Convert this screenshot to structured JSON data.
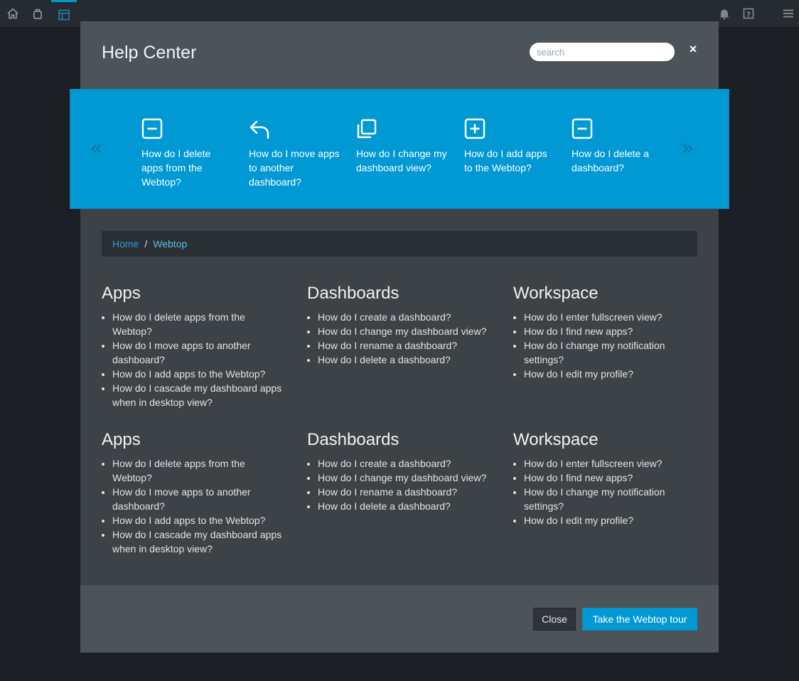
{
  "topbar": {
    "left_icons": [
      "home-icon",
      "bag-icon",
      "layout-icon"
    ],
    "right_icons": [
      "bell-icon",
      "help-icon",
      "menu-icon"
    ],
    "accent": "#0099cc"
  },
  "modal": {
    "title": "Help Center",
    "search_placeholder": "search",
    "close_glyph": "×"
  },
  "carousel": {
    "prev_glyph": "«",
    "next_glyph": "»",
    "items": [
      {
        "icon": "minus-square-icon",
        "label": "How do I delete apps from the Webtop?"
      },
      {
        "icon": "reply-arrow-icon",
        "label": "How do I move apps to another dashboard?"
      },
      {
        "icon": "copy-icon",
        "label": "How do I change my dashboard view?"
      },
      {
        "icon": "plus-square-icon",
        "label": "How do I add apps to the Webtop?"
      },
      {
        "icon": "minus-square-icon",
        "label": "How do I delete a dashboard?"
      }
    ],
    "background": "#0099d4"
  },
  "breadcrumb": {
    "home": "Home",
    "separator": "/",
    "current": "Webtop"
  },
  "sections": [
    {
      "title": "Apps",
      "items": [
        "How do I delete apps from the Webtop?",
        "How do I move apps to another dashboard?",
        "How do I add apps to the Webtop?",
        "How do I cascade my dashboard apps when in desktop view?"
      ]
    },
    {
      "title": "Dashboards",
      "items": [
        "How do I create a dashboard?",
        "How do I change my dashboard view?",
        "How do I rename a dashboard?",
        "How do I delete a dashboard?"
      ]
    },
    {
      "title": "Workspace",
      "items": [
        "How do I enter fullscreen view?",
        "How do I find new apps?",
        "How do I change my notification settings?",
        "How do I edit my profile?"
      ]
    },
    {
      "title": "Apps",
      "items": [
        "How do I delete apps from the Webtop?",
        "How do I move apps to another dashboard?",
        "How do I add apps to the Webtop?",
        "How do I cascade my dashboard apps when in desktop view?"
      ]
    },
    {
      "title": "Dashboards",
      "items": [
        "How do I create a dashboard?",
        "How do I change my dashboard view?",
        "How do I rename a dashboard?",
        "How do I delete a dashboard?"
      ]
    },
    {
      "title": "Workspace",
      "items": [
        "How do I enter fullscreen view?",
        "How do I find new apps?",
        "How do I change my notification settings?",
        "How do I edit my profile?"
      ]
    }
  ],
  "footer": {
    "close_label": "Close",
    "tour_label": "Take the Webtop tour"
  }
}
